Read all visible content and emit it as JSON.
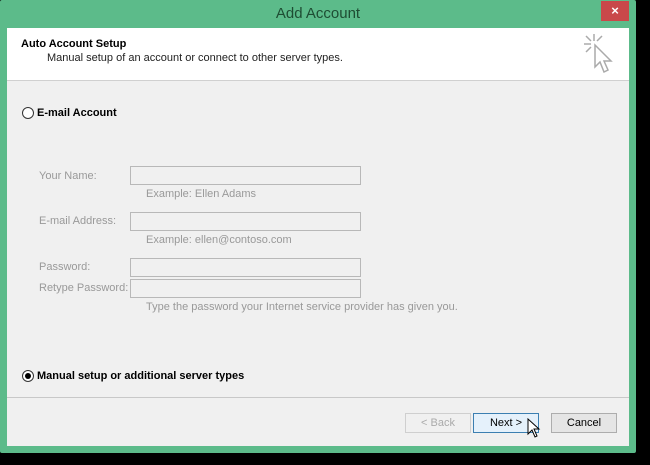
{
  "window": {
    "title": "Add Account",
    "close": "×"
  },
  "header": {
    "title": "Auto Account Setup",
    "subtitle": "Manual setup of an account or connect to other server types."
  },
  "email_option": {
    "label": "E-mail Account",
    "selected": false
  },
  "fields": {
    "name": {
      "label": "Your Name:",
      "value": "",
      "example": "Example: Ellen Adams"
    },
    "email": {
      "label": "E-mail Address:",
      "value": "",
      "example": "Example: ellen@contoso.com"
    },
    "password": {
      "label": "Password:",
      "value": ""
    },
    "retype": {
      "label": "Retype Password:",
      "value": "",
      "hint": "Type the password your Internet service provider has given you."
    }
  },
  "manual_option": {
    "label": "Manual setup or additional server types",
    "selected": true
  },
  "buttons": {
    "back": "< Back",
    "next": "Next >",
    "cancel": "Cancel"
  }
}
